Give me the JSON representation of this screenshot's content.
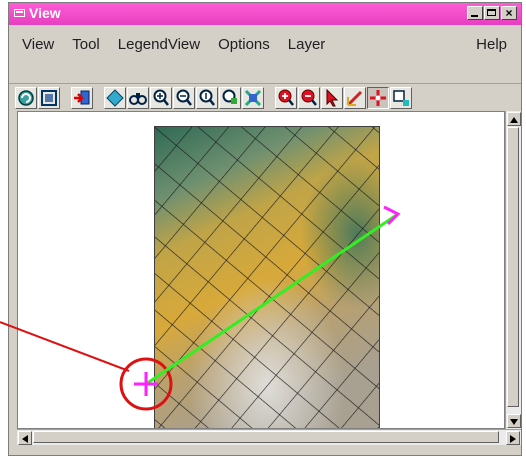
{
  "window": {
    "title": "View"
  },
  "menu": {
    "items": [
      "View",
      "Tool",
      "LegendView",
      "Options",
      "Layer"
    ],
    "help": "Help"
  },
  "toolbar": {
    "buttons": [
      {
        "name": "redraw-icon",
        "pressed": false
      },
      {
        "name": "full-view-icon",
        "pressed": false
      },
      {
        "name": "add-layer-icon",
        "pressed": false
      },
      {
        "name": "legend-icon",
        "pressed": false
      },
      {
        "name": "binoculars-icon",
        "pressed": false
      },
      {
        "name": "zoom-in-icon",
        "pressed": false
      },
      {
        "name": "zoom-out-icon",
        "pressed": false
      },
      {
        "name": "zoom-1x-icon",
        "pressed": false
      },
      {
        "name": "zoom-box-icon",
        "pressed": false
      },
      {
        "name": "zoom-to-layer-icon",
        "pressed": false
      },
      {
        "name": "zoom-in-red-icon",
        "pressed": false
      },
      {
        "name": "zoom-out-red-icon",
        "pressed": false
      },
      {
        "name": "select-arrow-icon",
        "pressed": false
      },
      {
        "name": "measure-icon",
        "pressed": false
      },
      {
        "name": "crosshair-icon",
        "pressed": true
      },
      {
        "name": "tool-box-icon",
        "pressed": false
      }
    ]
  },
  "colors": {
    "titlebar": "#e63fbf",
    "vector": "#33ee22",
    "vector_endpoint": "#ff22ff",
    "callout": "#dd1111",
    "grid_lines": "#1a1a1a"
  }
}
